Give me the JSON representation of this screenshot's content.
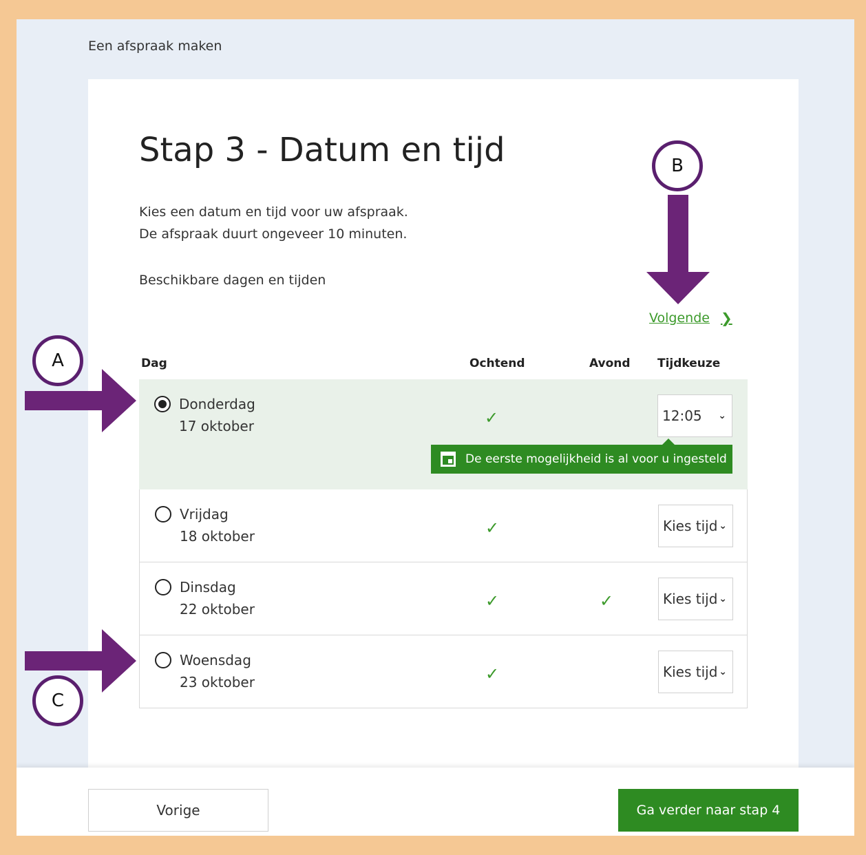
{
  "breadcrumb": "Een afspraak maken",
  "title": "Stap 3 - Datum en tijd",
  "intro": {
    "line1": "Kies een datum en tijd voor uw afspraak.",
    "line2": "De afspraak duurt ongeveer 10 minuten."
  },
  "available_label": "Beschikbare dagen en tijden",
  "next_link": "Volgende",
  "columns": {
    "day": "Dag",
    "morning": "Ochtend",
    "evening": "Avond",
    "time": "Tijdkeuze"
  },
  "rows": [
    {
      "day": "Donderdag",
      "date": "17 oktober",
      "morning": true,
      "evening": false,
      "time": "12:05",
      "selected": true
    },
    {
      "day": "Vrijdag",
      "date": "18 oktober",
      "morning": true,
      "evening": false,
      "time": "Kies tijd",
      "selected": false
    },
    {
      "day": "Dinsdag",
      "date": "22 oktober",
      "morning": true,
      "evening": true,
      "time": "Kies tijd",
      "selected": false
    },
    {
      "day": "Woensdag",
      "date": "23 oktober",
      "morning": true,
      "evening": false,
      "time": "Kies tijd",
      "selected": false
    }
  ],
  "hint": "De eerste mogelijkheid is al voor u ingesteld",
  "buttons": {
    "previous": "Vorige",
    "continue": "Ga verder naar stap 4"
  },
  "annotations": {
    "a": "A",
    "b": "B",
    "c": "C"
  },
  "colors": {
    "accent_green": "#2e8b22",
    "link_green": "#3c9a2b",
    "annotation_purple": "#6b2477",
    "border_orange": "#f5c894"
  }
}
